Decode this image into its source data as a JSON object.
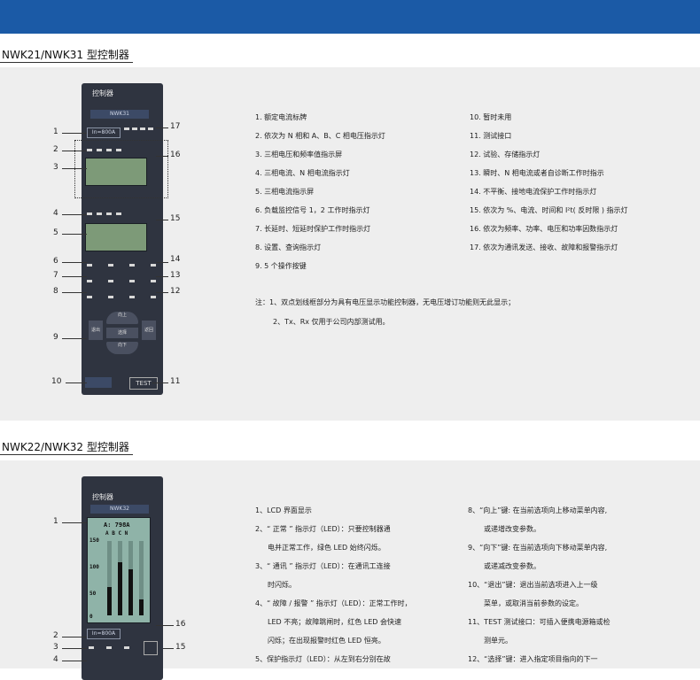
{
  "section1": {
    "title": "NWK21/NWK31 型控制器",
    "device": {
      "title": "控制器",
      "model": "NWK31",
      "rating": "In=800A",
      "test_label": "TEST",
      "keys": {
        "up": "向上",
        "down": "向下",
        "select": "选择",
        "exit": "退出",
        "return": "返回"
      },
      "callouts": [
        "1",
        "2",
        "3",
        "4",
        "5",
        "6",
        "7",
        "8",
        "9",
        "10",
        "11",
        "12",
        "13",
        "14",
        "15",
        "16",
        "17"
      ]
    },
    "list_left": [
      "1. 额定电流标牌",
      "2. 依次为 N 相和 A、B、C 相电压指示灯",
      "3. 三相电压和频率值指示屏",
      "4. 三相电流、N 相电流指示灯",
      "5. 三相电流指示屏",
      "6. 负载监控信号 1，2 工作时指示灯",
      "7. 长延时、短延时保护工作时指示灯",
      "8. 设置、查询指示灯",
      "9. 5 个操作按键"
    ],
    "list_right": [
      "10. 暂时未用",
      "11. 测试接口",
      "12. 试验、存储指示灯",
      "13. 瞬时、N 相电流或者自诊断工作时指示",
      "14. 不平衡、接地电流保护工作时指示灯",
      "15. 依次为 %、电流、时间和 I²t( 反时限 ) 指示灯",
      "16. 依次为频率、功率、电压和功率因数指示灯",
      "17. 依次为通讯发送、接收、故障和报警指示灯"
    ],
    "note_1": "注：1、双点划线框部分为具有电压显示功能控制器，无电压增订功能则无此显示；",
    "note_2": "2、Tx、Rx 仅用于公司内部测试用。"
  },
  "section2": {
    "title": "NWK22/NWK32 型控制器",
    "device": {
      "title": "控制器",
      "model": "NWK32",
      "rating": "In=800A",
      "lcd_header": "A: 798A",
      "lcd_cols": "A  B  C  N",
      "lcd_ticks": [
        "150",
        "100",
        "50",
        "0"
      ],
      "bar_levels": [
        0.38,
        0.72,
        0.62,
        0.22
      ],
      "callouts": [
        "1",
        "2",
        "3",
        "4",
        "15",
        "16"
      ]
    },
    "list_left": [
      "1、LCD 界面显示",
      "2、“ 正常 ” 指示灯（LED）：只要控制器通",
      "电并正常工作，绿色 LED 始终闪烁。",
      "3、“ 通讯 ” 指示灯（LED）：在通讯工连接",
      "时闪烁。",
      "4、“ 故障 / 报警 ” 指示灯（LED）：正常工作时，",
      "LED 不亮；故障跳闸时，红色 LED 会快速",
      "闪烁；在出现报警时红色 LED 恒亮。",
      "5、保护指示灯（LED）：从左到右分别在故"
    ],
    "list_right": [
      "8、“向上”键: 在当前选项向上移动菜单内容,",
      "或递增改变参数。",
      "9、“向下”键: 在当前选项向下移动菜单内容,",
      "或递减改变参数。",
      "10、“退出”键：退出当前选项进入上一级",
      "菜单，或取消当前参数的设定。",
      "11、TEST 测试接口：可插入便携电源箱或检",
      "测单元。",
      "12、“选择”键：进入指定项目指向的下一"
    ]
  }
}
